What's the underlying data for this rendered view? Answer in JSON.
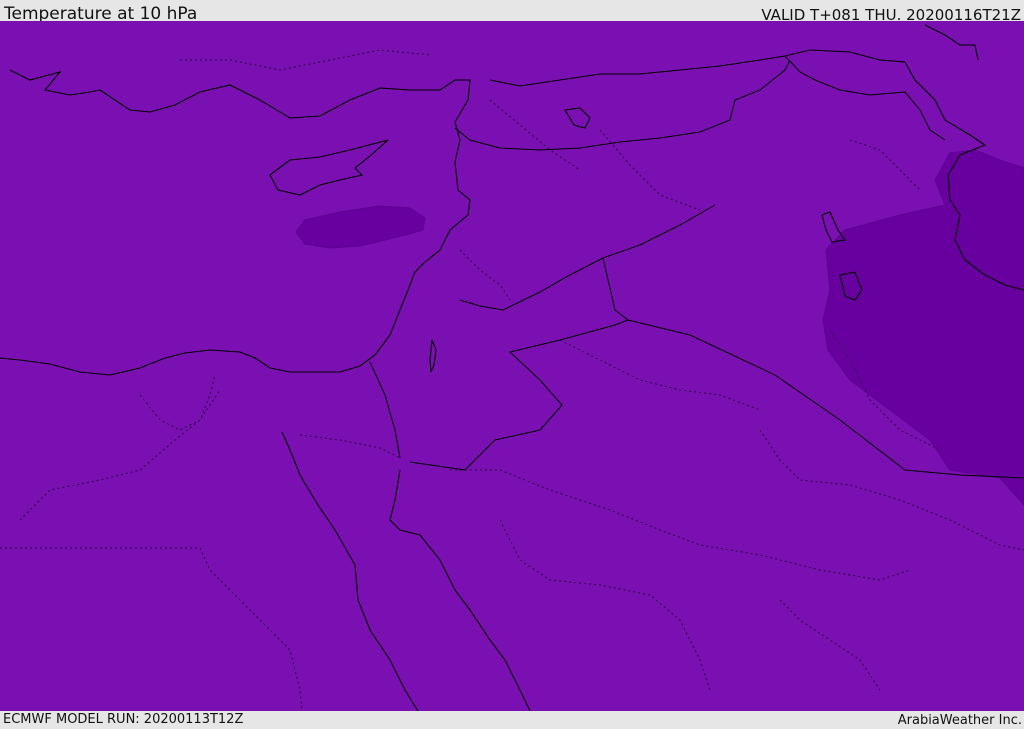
{
  "header": {
    "title": "Temperature at 10 hPa",
    "valid": "VALID T+081 THU. 20200116T21Z"
  },
  "footer": {
    "model_run": "ECMWF MODEL RUN: 20200113T12Z",
    "credit": "ArabiaWeather Inc."
  },
  "map": {
    "base_fill_color": "#7a10b2",
    "cold_region_color": "#6800a0",
    "boundary_color": "#000000"
  }
}
